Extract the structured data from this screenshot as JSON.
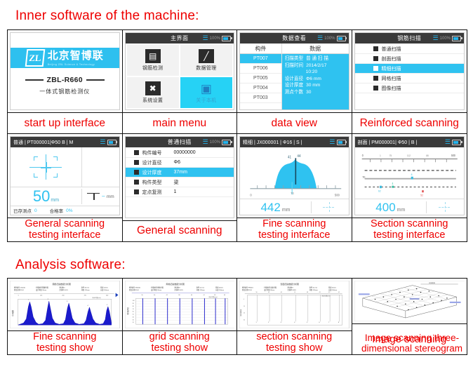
{
  "headings": {
    "inner": "Inner software of the machine:",
    "analysis": "Analysis software:"
  },
  "colors": {
    "accent_cyan": "#2fc2f0",
    "caption_red": "#ee0000",
    "topbar_dark": "#3a3a3a",
    "chart_blue": "#0000cc",
    "tile_active": "#26d2f5"
  },
  "common": {
    "battery_pct": "100%",
    "bluetooth_icon": "bluetooth-icon",
    "battery_icon": "battery-icon"
  },
  "inner_panels": [
    {
      "caption": "start up interface",
      "type": "startup",
      "logo": {
        "mark": "ZL",
        "chinese": "北京智博联",
        "english": "Beijing ZBL Science & Technology"
      },
      "model": "ZBL-R660",
      "subtitle": "一体式钢筋检测仪"
    },
    {
      "caption": "main menu",
      "type": "menu",
      "title": "主界面",
      "tiles": [
        {
          "label": "钢筋检测",
          "icon": "rebar-icon",
          "glyph": "▤",
          "active": false
        },
        {
          "label": "数据管理",
          "icon": "chart-icon",
          "glyph": "📈",
          "active": false
        },
        {
          "label": "系统设置",
          "icon": "tools-icon",
          "glyph": "✕",
          "active": false
        },
        {
          "label": "关于本机",
          "icon": "monitor-icon",
          "glyph": "🖵",
          "active": true
        }
      ]
    },
    {
      "caption": "data view",
      "type": "dataview",
      "title": "数据查看",
      "col_headers": [
        "构件",
        "数据"
      ],
      "rows": [
        "PT007",
        "PT006",
        "PT005",
        "PT004",
        "PT003"
      ],
      "selected_row": "PT007",
      "detail": [
        {
          "key": "扫描类型",
          "value": "普 通 扫 描"
        },
        {
          "key": "扫描时间",
          "value": "2014/2/17"
        },
        {
          "key": "",
          "value": "10:20"
        },
        {
          "key": "设计直径",
          "value": "Φ6 mm"
        },
        {
          "key": "设计厚度",
          "value": "30 mm"
        },
        {
          "key": "测点个数",
          "value": "30"
        }
      ]
    },
    {
      "caption": "Reinforced scanning",
      "type": "list",
      "title": "钢筋扫描",
      "items": [
        {
          "label": "普通扫描",
          "selected": false
        },
        {
          "label": "剖面扫描",
          "selected": false
        },
        {
          "label": "精细扫描",
          "selected": true
        },
        {
          "label": "网格扫描",
          "selected": false
        },
        {
          "label": "图像扫描",
          "selected": false
        }
      ]
    },
    {
      "caption": "General scanning testing interface",
      "caption_lines": [
        "General scanning",
        "testing interface"
      ],
      "type": "general-test",
      "title": "普通 | PT000001|Φ50  B | M",
      "reading": "50",
      "reading_unit": "mm",
      "depth_value": "---",
      "depth_unit": "mm",
      "stats": [
        {
          "key": "已存测点",
          "value": "0"
        },
        {
          "key": "合格率",
          "value": "0%"
        }
      ]
    },
    {
      "caption": "General scanning",
      "type": "params",
      "title": "普通扫描",
      "params": [
        {
          "key": "构件编号",
          "value": "00000000",
          "selected": false
        },
        {
          "key": "设计直径",
          "value": "Φ6",
          "selected": false
        },
        {
          "key": "设计厚度",
          "value": "37mm",
          "selected": true
        },
        {
          "key": "构件类型",
          "value": "梁",
          "selected": false
        },
        {
          "key": "定点复测",
          "value": "1",
          "selected": false
        }
      ]
    },
    {
      "caption": "Fine scanning testing interface",
      "caption_lines": [
        "Fine scanning",
        "testing interface"
      ],
      "type": "fine-test",
      "title": "精细 | JX000001 | Φ16 | S |",
      "reading": "442",
      "reading_unit": "mm",
      "axis_start": "0",
      "axis_end": "500",
      "axis_mid": "73",
      "peak_labels": [
        "41",
        "44"
      ]
    },
    {
      "caption": "Section scanning testing interface",
      "caption_lines": [
        "Section scanning",
        "testing interface"
      ],
      "type": "section-test",
      "title": "剖面 | PM000001| Φ50 | B |",
      "reading": "400",
      "reading_unit": "mm",
      "ruler_start": "0",
      "ruler_end": "500",
      "ruler_ticks": [
        "1",
        "75",
        "112",
        "88"
      ],
      "row_label": "50",
      "markers": [
        "62",
        "4",
        "52"
      ]
    }
  ],
  "analysis_panels": [
    {
      "caption_lines": [
        "Fine scanning",
        "testing show"
      ],
      "type": "peaks",
      "chart_title": "钢筋扫描数据分析图",
      "ylabel": "信号幅值",
      "axis_note": "测点位置(mm)"
    },
    {
      "caption_lines": [
        "grid scanning",
        "testing show"
      ],
      "type": "grid-lines",
      "chart_title": "网格扫描数据分析图",
      "ylabel": "保护层厚度"
    },
    {
      "caption_lines": [
        "section scanning",
        "testing show"
      ],
      "type": "section-lines",
      "chart_title": "剖面扫描数据分析图",
      "ylabel": "保护层厚度"
    },
    {
      "caption_lines": [
        "Image scanning"
      ],
      "caption_extra_lines": [
        "Image scanning three-",
        "dimensional stereogram"
      ],
      "type": "stereogram"
    }
  ],
  "chart_data": [
    {
      "type": "line",
      "name": "fine-scanning-signal",
      "title": "钢筋扫描数据分析图",
      "xlabel": "测点位置(mm)",
      "ylabel": "信号幅值",
      "peak_positions": [
        30,
        95,
        165,
        235,
        300
      ],
      "peak_values": [
        88,
        92,
        80,
        62,
        58
      ],
      "labels": [
        "1",
        "2",
        "3",
        "4",
        "5"
      ],
      "ylim": [
        0,
        100
      ],
      "grid": false
    },
    {
      "type": "bar",
      "name": "grid-scanning",
      "title": "网格扫描数据分析图",
      "ylabel": "保护层厚度",
      "categories": [
        "1",
        "2",
        "3",
        "4",
        "5",
        "6",
        "7",
        "8"
      ],
      "values": [
        100,
        100,
        100,
        100,
        100,
        100,
        100,
        100
      ],
      "ylim": [
        0,
        100
      ],
      "grid": true
    },
    {
      "type": "bar",
      "name": "section-scanning",
      "title": "剖面扫描数据分析图",
      "ylabel": "保护层厚度",
      "categories": [
        "1",
        "2",
        "3",
        "4",
        "5",
        "6",
        "7",
        "8"
      ],
      "values": [
        100,
        100,
        100,
        100,
        100,
        100,
        100,
        100
      ],
      "ylim": [
        0,
        100
      ],
      "grid": true
    },
    {
      "type": "scatter",
      "name": "image-scanning-3d",
      "title": "Image scanning three-dimensional stereogram",
      "grid": true
    }
  ]
}
